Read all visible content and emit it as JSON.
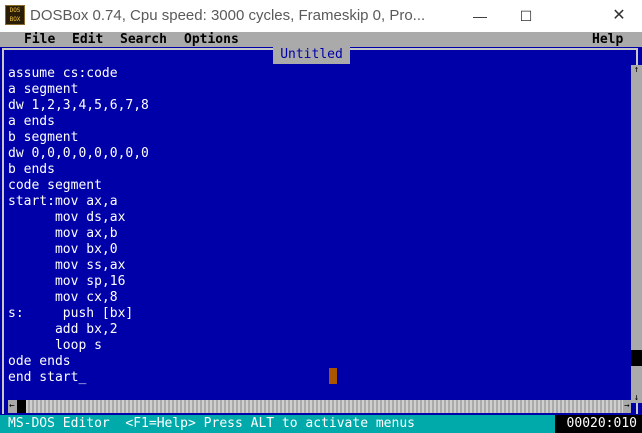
{
  "window": {
    "title": "DOSBox 0.74, Cpu speed:     3000 cycles, Frameskip  0, Pro...",
    "icon_label": "DOS BOX",
    "minimize": "—",
    "maximize": "☐",
    "close": "✕"
  },
  "menu": {
    "file": "File",
    "edit": "Edit",
    "search": "Search",
    "options": "Options",
    "help": "Help"
  },
  "editor": {
    "document_title": "Untitled",
    "lines": [
      "assume cs:code",
      "a segment",
      "dw 1,2,3,4,5,6,7,8",
      "a ends",
      "b segment",
      "dw 0,0,0,0,0,0,0,0",
      "b ends",
      "code segment",
      "start:mov ax,a",
      "      mov ds,ax",
      "      mov ax,b",
      "      mov bx,0",
      "      mov ss,ax",
      "      mov sp,16",
      "      mov cx,8",
      "s:     push [bx]",
      "      add bx,2",
      "      loop s",
      "ode ends",
      "end start_"
    ]
  },
  "scrollbars": {
    "up_arrow": "↑",
    "down_arrow": "↓",
    "left_arrow": "←",
    "right_arrow": "→"
  },
  "status": {
    "text": "MS-DOS Editor  <F1=Help> Press ALT to activate menus",
    "position": "00020:010"
  },
  "colors": {
    "dos_background": "#0000a8",
    "menubar": "#aaaaaa",
    "statusbar": "#00aaaa",
    "cursor_block": "#aa5500"
  }
}
